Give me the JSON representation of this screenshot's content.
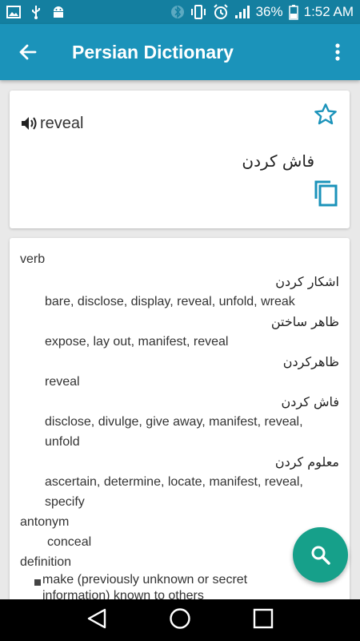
{
  "status_bar": {
    "battery": "36%",
    "time": "1:52 AM",
    "icons": [
      "image-icon",
      "usb-icon",
      "android-icon",
      "bluetooth-icon",
      "vibrate-icon",
      "alarm-icon",
      "signal-icon",
      "battery-icon"
    ]
  },
  "app_bar": {
    "title": "Persian Dictionary",
    "back_icon": "arrow-back-icon",
    "menu_icon": "more-vert-icon"
  },
  "word_card": {
    "word": "reveal",
    "translation": "فاش کردن",
    "icons": [
      "speaker-icon",
      "star-outline-icon",
      "copy-icon"
    ]
  },
  "definitions": {
    "verb_label": "verb",
    "senses": [
      {
        "fa": "اشکار کردن",
        "en": "bare, disclose, display, reveal, unfold, wreak"
      },
      {
        "fa": "ظاهر ساختن",
        "en": "expose, lay out, manifest, reveal"
      },
      {
        "fa": "ظاهرکردن",
        "en": "reveal"
      },
      {
        "fa": "فاش کردن",
        "en": "disclose, divulge, give away, manifest, reveal,",
        "en2": "unfold"
      },
      {
        "fa": "معلوم کردن",
        "en": "ascertain, determine, locate, manifest, reveal,",
        "en2": "specify"
      }
    ],
    "antonym_label": "antonym",
    "antonym": "conceal",
    "definition_label": "definition",
    "definition_line1": "make (previously unknown or secret",
    "definition_line2": "information) known to others"
  },
  "fab": {
    "icon": "search-icon"
  },
  "nav_bar": {
    "icons": [
      "back-triangle-icon",
      "home-circle-icon",
      "recents-square-icon"
    ]
  },
  "colors": {
    "status_bar": "#147fa0",
    "app_bar": "#1b93ba",
    "accent": "#1b93ba",
    "fab": "#16a08a"
  }
}
